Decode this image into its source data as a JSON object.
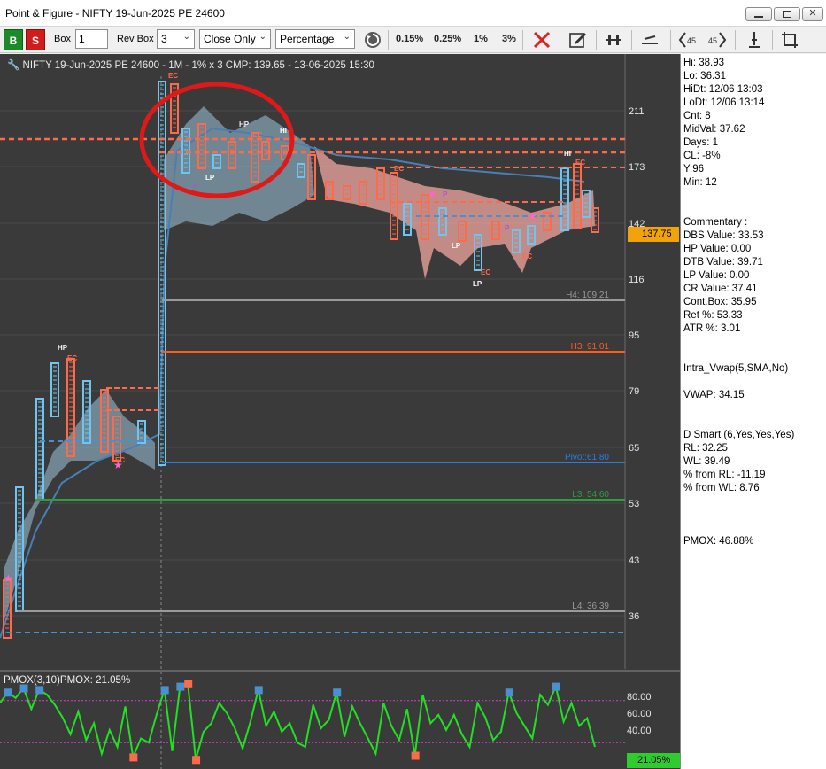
{
  "window": {
    "title": "Point & Figure - NIFTY 19-Jun-2025 PE 24600"
  },
  "toolbar": {
    "buy_label": "B",
    "sell_label": "S",
    "box_label": "Box",
    "box_value": "1",
    "rev_box_label": "Rev Box",
    "rev_box_value": "3",
    "mode_value": "Close Only",
    "scale_value": "Percentage",
    "pct_options": [
      "0.15%",
      "0.25%",
      "1%",
      "3%"
    ],
    "icons": [
      "refresh-icon",
      "close-x-icon",
      "edit-icon",
      "pin-icon",
      "line-tool-icon",
      "rotate-left-45-icon",
      "rotate-right-45-icon",
      "anchor-icon",
      "crop-icon"
    ]
  },
  "chart": {
    "header": "NIFTY 19-Jun-2025 PE 24600 - 1M - 1% x 3 CMP: 139.65 - 13-06-2025 15:30",
    "y_ticks": [
      "211",
      "173",
      "142",
      "116",
      "95",
      "79",
      "65",
      "53",
      "43",
      "36"
    ],
    "current_price": "137.75",
    "levels": [
      {
        "name": "H4",
        "label": "H4: 109.21",
        "color": "#9a9a9a"
      },
      {
        "name": "H3",
        "label": "H3: 91.01",
        "color": "#ff5a1f"
      },
      {
        "name": "Pivot",
        "label": "Pivot:61.80",
        "color": "#2a7de1"
      },
      {
        "name": "L3",
        "label": "L3: 54.60",
        "color": "#2e9e3e"
      },
      {
        "name": "L4",
        "label": "L4: 36.39",
        "color": "#9a9a9a"
      }
    ],
    "markers": [
      "HP",
      "EC",
      "LP",
      "P",
      "HI"
    ],
    "colors": {
      "background": "#3a3a3a",
      "up_column": "#6ec6f0",
      "down_column": "#ff6a4a",
      "band_blue": "#9cc7dd",
      "band_red": "#f2a79f",
      "highlight_circle": "#e01818"
    }
  },
  "pmox": {
    "label": "PMOX(3,10)PMOX: 21.05%",
    "y_ticks": [
      "80.00",
      "60.00",
      "40.00"
    ],
    "current": "21.05%",
    "values": [
      72,
      85,
      78,
      90,
      65,
      88,
      82,
      70,
      55,
      35,
      62,
      28,
      48,
      12,
      40,
      20,
      68,
      8,
      30,
      25,
      58,
      88,
      15,
      92,
      95,
      5,
      38,
      48,
      72,
      60,
      42,
      18,
      50,
      88,
      45,
      62,
      38,
      48,
      25,
      20,
      70,
      42,
      52,
      85,
      32,
      68,
      48,
      30,
      12,
      72,
      45,
      28,
      65,
      10,
      82,
      48,
      58,
      40,
      58,
      35,
      20,
      72,
      55,
      28,
      38,
      85,
      60,
      45,
      30,
      82,
      70,
      92,
      50,
      72,
      45,
      54,
      20
    ],
    "overbought": 75,
    "oversold": 25
  },
  "right_panel": {
    "stats": [
      "Hi: 38.93",
      "Lo: 36.31",
      "HiDt: 12/06 13:03",
      "LoDt: 12/06 13:14",
      "Cnt: 8",
      "MidVal: 37.62",
      "Days: 1",
      "CL: -8%",
      "Y:96",
      "Min: 12"
    ],
    "commentary": [
      "Commentary :",
      "DBS Value:  33.53",
      "HP Value: 0.00",
      "DTB Value: 39.71",
      "LP Value: 0.00",
      "CR Value: 37.41",
      "Cont.Box: 35.95",
      "Ret %: 53.33",
      "ATR %: 3.01"
    ],
    "vwap_title": "Intra_Vwap(5,SMA,No)",
    "vwap_value": "VWAP: 34.15",
    "dsmart": [
      "D Smart (6,Yes,Yes,Yes)",
      "RL: 32.25",
      "WL: 39.49",
      "% from RL: -11.19",
      "% from WL: 8.76"
    ],
    "pmox_value": "PMOX: 46.88%"
  }
}
